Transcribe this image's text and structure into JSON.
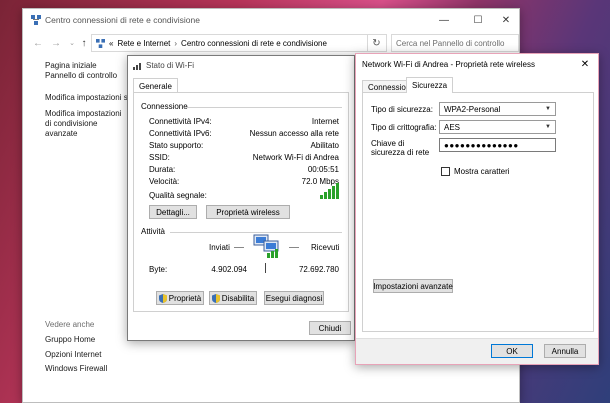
{
  "main_window": {
    "title": "Centro connessioni di rete e condivisione",
    "minimize_glyph": "—",
    "maximize_glyph": "☐",
    "close_glyph": "✕",
    "breadcrumb_prefix": "«",
    "breadcrumb": [
      "Rete e Internet",
      "Centro connessioni di rete e condivisione"
    ],
    "breadcrumb_separator": "›",
    "search_placeholder": "Cerca nel Pannello di controllo",
    "sidebar": [
      "Pagina iniziale Pannello di controllo",
      "Modifica impostazioni scheda",
      "Modifica impostazioni di condivisione avanzate"
    ],
    "see_also_heading": "Vedere anche",
    "see_also": [
      "Gruppo Home",
      "Opzioni Internet",
      "Windows Firewall"
    ]
  },
  "status_dialog": {
    "title": "Stato di Wi-Fi",
    "tab": "Generale",
    "connection_heading": "Connessione",
    "rows": [
      {
        "label": "Connettività IPv4:",
        "value": "Internet"
      },
      {
        "label": "Connettività IPv6:",
        "value": "Nessun accesso alla rete"
      },
      {
        "label": "Stato supporto:",
        "value": "Abilitato"
      },
      {
        "label": "SSID:",
        "value": "Network Wi-Fi di Andrea"
      },
      {
        "label": "Durata:",
        "value": "00:05:51"
      },
      {
        "label": "Velocità:",
        "value": "72.0 Mbps"
      }
    ],
    "signal_label": "Qualità segnale:",
    "details_button": "Dettagli...",
    "wireless_props_button": "Proprietà wireless",
    "activity_heading": "Attività",
    "sent_label": "Inviati",
    "received_label": "Ricevuti",
    "bytes_label": "Byte:",
    "bytes_sent": "4.902.094",
    "bytes_received": "72.692.780",
    "properties_button": "Proprietà",
    "disable_button": "Disabilita",
    "diagnose_button": "Esegui diagnosi",
    "close_button": "Chiudi"
  },
  "security_dialog": {
    "title": "Network Wi-Fi di Andrea - Proprietà rete wireless",
    "close_glyph": "✕",
    "tabs": [
      "Connessione",
      "Sicurezza"
    ],
    "security_type_label": "Tipo di sicurezza:",
    "security_type_value": "WPA2-Personal",
    "encryption_type_label": "Tipo di crittografia:",
    "encryption_type_value": "AES",
    "key_label": "Chiave di sicurezza di rete",
    "key_value": "●●●●●●●●●●●●●●",
    "show_chars_label": "Mostra caratteri",
    "advanced_button": "Impostazioni avanzate",
    "ok_button": "OK",
    "cancel_button": "Annulla"
  },
  "colors": {
    "accent": "#0078d7",
    "signal_green": "#2aa12a"
  }
}
